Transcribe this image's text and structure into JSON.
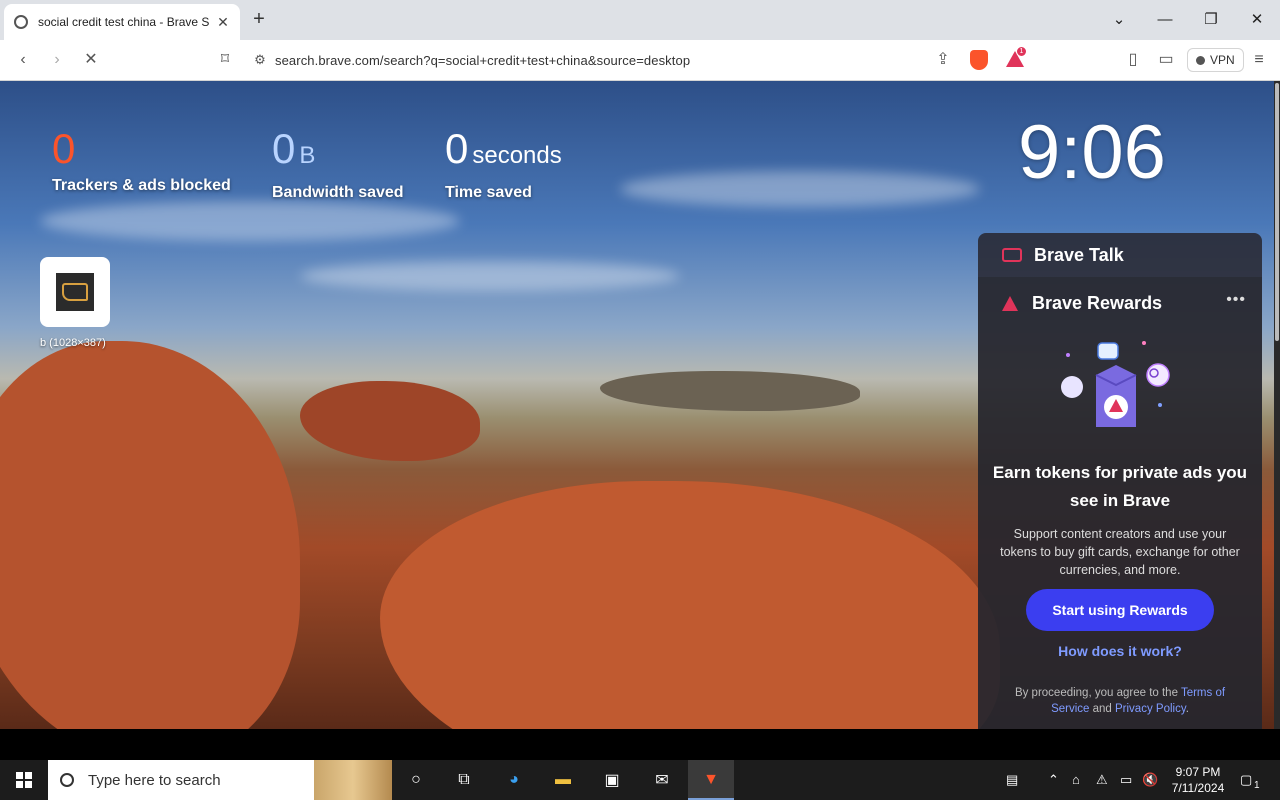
{
  "tab": {
    "title": "social credit test china - Brave S"
  },
  "address": {
    "url": "search.brave.com/search?q=social+credit+test+china&source=desktop"
  },
  "toolbar": {
    "vpn_label": "VPN",
    "rewards_badge": "1"
  },
  "stats": {
    "trackers": {
      "value": "0",
      "label": "Trackers & ads blocked"
    },
    "bandwidth": {
      "value": "0",
      "unit": "B",
      "label": "Bandwidth saved"
    },
    "time": {
      "value": "0",
      "unit": "seconds",
      "label": "Time saved"
    }
  },
  "clock": "9:06",
  "top_site": {
    "label": "b (1028×387)"
  },
  "brave_talk": {
    "title": "Brave Talk"
  },
  "rewards": {
    "title": "Brave Rewards",
    "more": "•••",
    "headline": "Earn tokens for private ads you see in Brave",
    "body": "Support content creators and use your tokens to buy gift cards, exchange for other currencies, and more.",
    "button": "Start using Rewards",
    "link": "How does it work?",
    "legal_prefix": "By proceeding, you agree to the ",
    "legal_terms": "Terms of Service",
    "legal_and": " and ",
    "legal_privacy": "Privacy Policy",
    "legal_suffix": "."
  },
  "taskbar": {
    "search_placeholder": "Type here to search",
    "time": "9:07 PM",
    "date": "7/11/2024",
    "notification_count": "1"
  },
  "colors": {
    "accent": "#3b3ef0",
    "brave_orange": "#fb542b",
    "rewards_red": "#e0345a",
    "tracker_value": "#fb542b"
  }
}
